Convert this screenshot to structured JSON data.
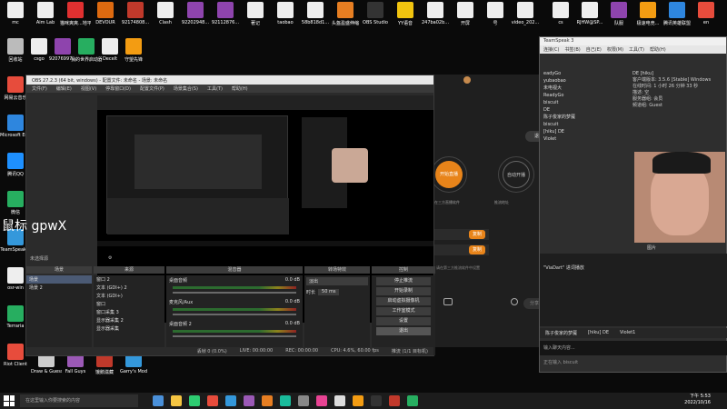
{
  "desktop_left": [
    {
      "label": "mc",
      "color": "#eeeeee"
    },
    {
      "label": "Aim Lab",
      "color": "#eeeeee"
    },
    {
      "label": "猫咪爽爽...地平线 5",
      "color": "#e03030"
    },
    {
      "label": "DEVOUR",
      "color": "#dd6a10"
    },
    {
      "label": "92174808...",
      "color": "#c0392b"
    },
    {
      "label": "Clash",
      "color": "#eeeeee"
    },
    {
      "label": "92202948...",
      "color": "#8e44ad"
    },
    {
      "label": "92112876...",
      "color": "#8e44ad"
    },
    {
      "label": "著记",
      "color": "#eeeeee"
    },
    {
      "label": "taobao",
      "color": "#eeeeee"
    },
    {
      "label": "58b818d1...",
      "color": "#eeeeee"
    },
    {
      "label": "头盔盈盛伸缩",
      "color": "#e67e22"
    },
    {
      "label": "OBS Studio",
      "color": "#333333"
    },
    {
      "label": "YY语音",
      "color": "#f1c40f"
    },
    {
      "label": "247ba02b...",
      "color": "#eeeeee"
    },
    {
      "label": "开屏",
      "color": "#eeeeee"
    },
    {
      "label": "号",
      "color": "#eeeeee"
    },
    {
      "label": "video_202...",
      "color": "#eeeeee"
    }
  ],
  "desktop_row2": [
    {
      "label": "回收站",
      "color": "#bbbbbb"
    },
    {
      "label": "csgo",
      "color": "#eeeeee"
    },
    {
      "label": "92076997...",
      "color": "#8e44ad"
    },
    {
      "label": "我的世界启动器",
      "color": "#27ae60"
    },
    {
      "label": "Decelt",
      "color": "#eeeeee"
    },
    {
      "label": "守望先锋",
      "color": "#f39c12"
    }
  ],
  "desktop_column": [
    {
      "label": "网易云音乐",
      "color": "#e74c3c"
    },
    {
      "label": "Microsoft Edge",
      "color": "#2e86de"
    },
    {
      "label": "腾讯QQ",
      "color": "#1e90ff"
    },
    {
      "label": "微信",
      "color": "#27ae60"
    },
    {
      "label": "TeamSpeak 3",
      "color": "#3498db"
    },
    {
      "label": "osr-win",
      "color": "#eeeeee"
    },
    {
      "label": "Terraria",
      "color": "#27ae60"
    },
    {
      "label": "Riot Client",
      "color": "#e74c3c"
    }
  ],
  "desktop_bottom": [
    {
      "label": "Draw & Guess",
      "color": "#cccccc"
    },
    {
      "label": "Fall Guys",
      "color": "#9b59b6"
    },
    {
      "label": "饿鹅滋藏",
      "color": "#c0392b"
    },
    {
      "label": "Garry's Mod",
      "color": "#3498db"
    }
  ],
  "desktop_right": [
    {
      "label": "cs",
      "color": "#eeeeee"
    },
    {
      "label": "RJHW@SP...",
      "color": "#eeeeee"
    },
    {
      "label": "队服",
      "color": "#8e44ad"
    },
    {
      "label": "极速电竞...",
      "color": "#f39c12"
    },
    {
      "label": "腾讯英雄联盟",
      "color": "#2e86de"
    },
    {
      "label": "en",
      "color": "#e74c3c"
    }
  ],
  "overlay_text": "鼠标 gpwX",
  "obs": {
    "title": "OBS 27.2.3 (64 bit, windows) - 配置文件: 未命名 - 场景: 未命名",
    "menu": [
      "文件(F)",
      "编辑(E)",
      "视图(V)",
      "停靠窗口(D)",
      "配置文件(P)",
      "场景集合(S)",
      "工具(T)",
      "帮助(H)"
    ],
    "scene_label": "未选择源",
    "docks": {
      "scenes": "场景",
      "sources": "来源",
      "mixer": "混音器",
      "transitions": "转场特效",
      "controls": "控制"
    },
    "scenes": [
      "场景",
      "场景 2"
    ],
    "sources": [
      "窗口 2",
      "文本 (GDI+) 2",
      "文本 (GDI+)",
      "窗口",
      "窗口采集 3",
      "显示器采集 2",
      "显示器采集"
    ],
    "mixer": [
      {
        "name": "桌面音频",
        "db": "0.0 dB"
      },
      {
        "name": "麦克风/Aux",
        "db": "0.0 dB"
      },
      {
        "name": "桌面音频 2",
        "db": "0.0 dB"
      }
    ],
    "transition": {
      "name": "淡出",
      "duration_label": "时长",
      "duration": "50 ms"
    },
    "controls": [
      "停止推流",
      "开始录制",
      "启动虚拟摄像机",
      "工作室模式",
      "设置",
      "退出"
    ],
    "status": {
      "drop": "丢帧 0 (0.0%)",
      "live": "LIVE: 00:00:00",
      "rec": "REC: 00:00:00",
      "cpu": "CPU: 4.6%, 60.00 fps",
      "stream_status": "推流 (1/1 目标机)"
    }
  },
  "mid_app": {
    "quit_label": "退出",
    "live_label": "开始直播",
    "auto_label": "自动开播",
    "hint1": "在三方直播软件",
    "hint2": "推流地址",
    "copy": "复制",
    "copy2": "复制",
    "footer_hint": "请在第三方推流软件中设置",
    "share_label": "分享直播"
  },
  "teamspeak": {
    "title": "TeamSpeak 3",
    "menu": [
      "连接(C)",
      "书签(B)",
      "自己(E)",
      "权限(M)",
      "工具(T)",
      "帮助(H)"
    ],
    "tree": [
      "eadyGo",
      "yubaobao",
      "未电视大",
      "ReadyGo",
      "biscuit",
      "DE",
      "陈子俊家的梦魇",
      "biscuit",
      "[hiku] DE",
      "Violet"
    ],
    "info_title": "DE [hiku]",
    "info": [
      {
        "k": "客户端版本:",
        "v": "3.5.6 [Stable] Windows"
      },
      {
        "k": "在线时间:",
        "v": "1 小时 26 分钟 33 秒"
      },
      {
        "k": "描述:",
        "v": "空"
      },
      {
        "k": "服务器组:",
        "v": "会员"
      },
      {
        "k": "频道组:",
        "v": "Guest"
      }
    ],
    "avatar_caption": "图片",
    "chat_line": "\"ViaDart\" 进词播放",
    "tabs": [
      "陈子俊家的梦魇",
      "[hiku] DE",
      "Violet1"
    ],
    "input_placeholder": "输入聊天内容...",
    "typing": "正在输入 biscuit"
  },
  "taskbar": {
    "search_placeholder": "在这里输入你要搜索的内容",
    "time": "下午 5:53",
    "date": "2022/10/16"
  }
}
